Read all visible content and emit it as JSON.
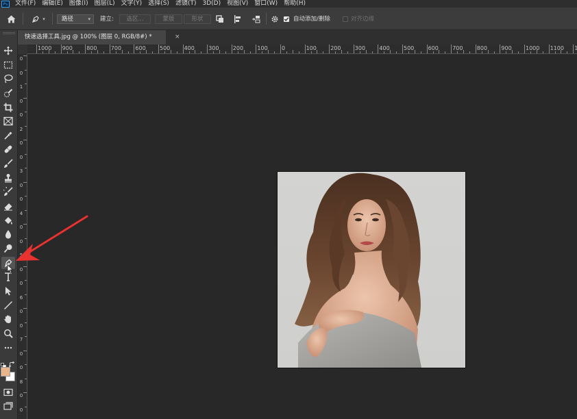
{
  "app": {
    "logo_text": "Ps"
  },
  "menu": [
    "文件(F)",
    "编辑(E)",
    "图像(I)",
    "图层(L)",
    "文字(Y)",
    "选择(S)",
    "滤镜(T)",
    "3D(D)",
    "视图(V)",
    "窗口(W)",
    "帮助(H)"
  ],
  "options_bar": {
    "mode_value": "路径",
    "make_label": "建立:",
    "selection_button": "选区...",
    "mask_button": "蒙版",
    "shape_button": "形状",
    "auto_add_delete_label": "自动添加/删除",
    "auto_add_delete_checked": true,
    "align_edges_label": "对齐边缘",
    "align_edges_checked": false
  },
  "document": {
    "tab_title": "快速选择工具.jpg @ 100% (图层 0, RGB/8#) *",
    "close_glyph": "×"
  },
  "rulers": {
    "horizontal": [
      "1000",
      "900",
      "800",
      "700",
      "600",
      "500",
      "400",
      "300",
      "200",
      "100",
      "0",
      "100",
      "200",
      "300",
      "400",
      "500",
      "600",
      "700",
      "800",
      "900",
      "1000",
      "1100",
      "12"
    ],
    "vertical": [
      "0",
      "0",
      "1",
      "0",
      "0",
      "2",
      "0",
      "0",
      "3",
      "0",
      "0",
      "4",
      "0",
      "0",
      "5",
      "0",
      "0",
      "6",
      "0",
      "0",
      "7",
      "0",
      "0",
      "8",
      "0",
      "0"
    ]
  },
  "tools": [
    {
      "name": "move-tool-icon"
    },
    {
      "name": "marquee-tool-icon"
    },
    {
      "name": "lasso-tool-icon"
    },
    {
      "name": "quick-selection-tool-icon"
    },
    {
      "name": "crop-tool-icon"
    },
    {
      "name": "frame-tool-icon"
    },
    {
      "name": "eyedropper-tool-icon"
    },
    {
      "name": "healing-brush-tool-icon"
    },
    {
      "name": "brush-tool-icon"
    },
    {
      "name": "clone-stamp-tool-icon"
    },
    {
      "name": "history-brush-tool-icon"
    },
    {
      "name": "eraser-tool-icon"
    },
    {
      "name": "paint-bucket-tool-icon"
    },
    {
      "name": "blur-tool-icon"
    },
    {
      "name": "dodge-tool-icon"
    },
    {
      "name": "pen-tool-icon",
      "active": true
    },
    {
      "name": "type-tool-icon"
    },
    {
      "name": "path-selection-tool-icon"
    },
    {
      "name": "line-tool-icon"
    },
    {
      "name": "hand-tool-icon"
    },
    {
      "name": "zoom-tool-icon"
    },
    {
      "name": "more-tools-icon"
    }
  ],
  "colors": {
    "foreground": "#e8b48c",
    "background": "#ffffff",
    "annotation_arrow": "#e8322f"
  }
}
